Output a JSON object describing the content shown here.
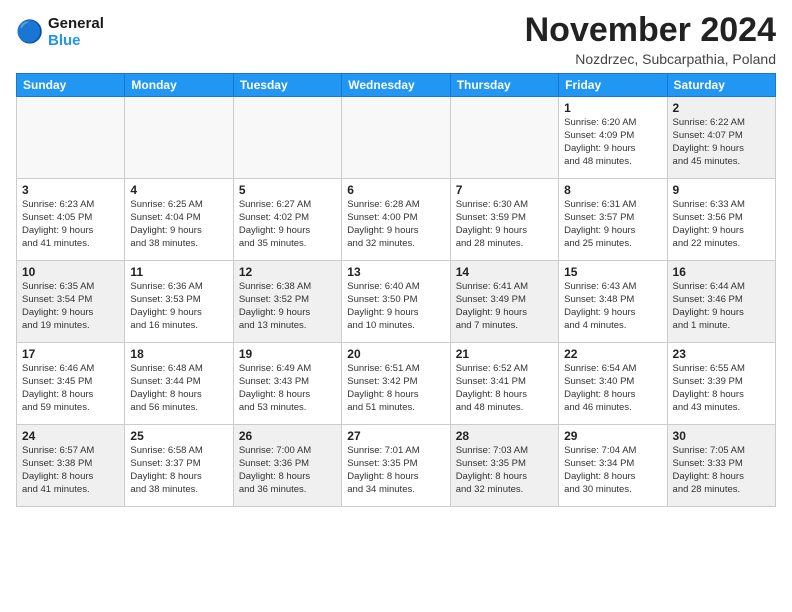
{
  "header": {
    "logo_line1": "General",
    "logo_line2": "Blue",
    "month_title": "November 2024",
    "location": "Nozdrzec, Subcarpathia, Poland"
  },
  "weekdays": [
    "Sunday",
    "Monday",
    "Tuesday",
    "Wednesday",
    "Thursday",
    "Friday",
    "Saturday"
  ],
  "weeks": [
    [
      {
        "day": "",
        "info": "",
        "empty": true
      },
      {
        "day": "",
        "info": "",
        "empty": true
      },
      {
        "day": "",
        "info": "",
        "empty": true
      },
      {
        "day": "",
        "info": "",
        "empty": true
      },
      {
        "day": "",
        "info": "",
        "empty": true
      },
      {
        "day": "1",
        "info": "Sunrise: 6:20 AM\nSunset: 4:09 PM\nDaylight: 9 hours\nand 48 minutes."
      },
      {
        "day": "2",
        "info": "Sunrise: 6:22 AM\nSunset: 4:07 PM\nDaylight: 9 hours\nand 45 minutes."
      }
    ],
    [
      {
        "day": "3",
        "info": "Sunrise: 6:23 AM\nSunset: 4:05 PM\nDaylight: 9 hours\nand 41 minutes."
      },
      {
        "day": "4",
        "info": "Sunrise: 6:25 AM\nSunset: 4:04 PM\nDaylight: 9 hours\nand 38 minutes."
      },
      {
        "day": "5",
        "info": "Sunrise: 6:27 AM\nSunset: 4:02 PM\nDaylight: 9 hours\nand 35 minutes."
      },
      {
        "day": "6",
        "info": "Sunrise: 6:28 AM\nSunset: 4:00 PM\nDaylight: 9 hours\nand 32 minutes."
      },
      {
        "day": "7",
        "info": "Sunrise: 6:30 AM\nSunset: 3:59 PM\nDaylight: 9 hours\nand 28 minutes."
      },
      {
        "day": "8",
        "info": "Sunrise: 6:31 AM\nSunset: 3:57 PM\nDaylight: 9 hours\nand 25 minutes."
      },
      {
        "day": "9",
        "info": "Sunrise: 6:33 AM\nSunset: 3:56 PM\nDaylight: 9 hours\nand 22 minutes."
      }
    ],
    [
      {
        "day": "10",
        "info": "Sunrise: 6:35 AM\nSunset: 3:54 PM\nDaylight: 9 hours\nand 19 minutes."
      },
      {
        "day": "11",
        "info": "Sunrise: 6:36 AM\nSunset: 3:53 PM\nDaylight: 9 hours\nand 16 minutes."
      },
      {
        "day": "12",
        "info": "Sunrise: 6:38 AM\nSunset: 3:52 PM\nDaylight: 9 hours\nand 13 minutes."
      },
      {
        "day": "13",
        "info": "Sunrise: 6:40 AM\nSunset: 3:50 PM\nDaylight: 9 hours\nand 10 minutes."
      },
      {
        "day": "14",
        "info": "Sunrise: 6:41 AM\nSunset: 3:49 PM\nDaylight: 9 hours\nand 7 minutes."
      },
      {
        "day": "15",
        "info": "Sunrise: 6:43 AM\nSunset: 3:48 PM\nDaylight: 9 hours\nand 4 minutes."
      },
      {
        "day": "16",
        "info": "Sunrise: 6:44 AM\nSunset: 3:46 PM\nDaylight: 9 hours\nand 1 minute."
      }
    ],
    [
      {
        "day": "17",
        "info": "Sunrise: 6:46 AM\nSunset: 3:45 PM\nDaylight: 8 hours\nand 59 minutes."
      },
      {
        "day": "18",
        "info": "Sunrise: 6:48 AM\nSunset: 3:44 PM\nDaylight: 8 hours\nand 56 minutes."
      },
      {
        "day": "19",
        "info": "Sunrise: 6:49 AM\nSunset: 3:43 PM\nDaylight: 8 hours\nand 53 minutes."
      },
      {
        "day": "20",
        "info": "Sunrise: 6:51 AM\nSunset: 3:42 PM\nDaylight: 8 hours\nand 51 minutes."
      },
      {
        "day": "21",
        "info": "Sunrise: 6:52 AM\nSunset: 3:41 PM\nDaylight: 8 hours\nand 48 minutes."
      },
      {
        "day": "22",
        "info": "Sunrise: 6:54 AM\nSunset: 3:40 PM\nDaylight: 8 hours\nand 46 minutes."
      },
      {
        "day": "23",
        "info": "Sunrise: 6:55 AM\nSunset: 3:39 PM\nDaylight: 8 hours\nand 43 minutes."
      }
    ],
    [
      {
        "day": "24",
        "info": "Sunrise: 6:57 AM\nSunset: 3:38 PM\nDaylight: 8 hours\nand 41 minutes."
      },
      {
        "day": "25",
        "info": "Sunrise: 6:58 AM\nSunset: 3:37 PM\nDaylight: 8 hours\nand 38 minutes."
      },
      {
        "day": "26",
        "info": "Sunrise: 7:00 AM\nSunset: 3:36 PM\nDaylight: 8 hours\nand 36 minutes."
      },
      {
        "day": "27",
        "info": "Sunrise: 7:01 AM\nSunset: 3:35 PM\nDaylight: 8 hours\nand 34 minutes."
      },
      {
        "day": "28",
        "info": "Sunrise: 7:03 AM\nSunset: 3:35 PM\nDaylight: 8 hours\nand 32 minutes."
      },
      {
        "day": "29",
        "info": "Sunrise: 7:04 AM\nSunset: 3:34 PM\nDaylight: 8 hours\nand 30 minutes."
      },
      {
        "day": "30",
        "info": "Sunrise: 7:05 AM\nSunset: 3:33 PM\nDaylight: 8 hours\nand 28 minutes."
      }
    ]
  ]
}
